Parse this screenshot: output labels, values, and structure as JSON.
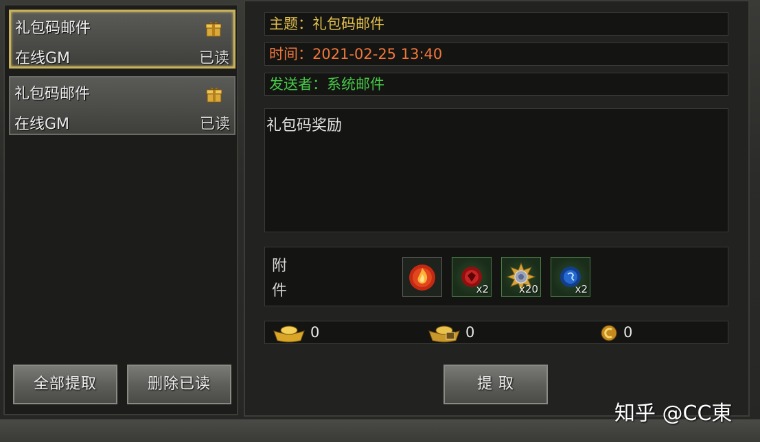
{
  "mail_list": [
    {
      "subject": "礼包码邮件",
      "sender": "在线GM",
      "status": "已读",
      "selected": true
    },
    {
      "subject": "礼包码邮件",
      "sender": "在线GM",
      "status": "已读",
      "selected": false
    }
  ],
  "buttons": {
    "claim_all": "全部提取",
    "delete_read": "删除已读",
    "claim": "提 取"
  },
  "detail": {
    "subject_label": "主题：",
    "subject": "礼包码邮件",
    "time_label": "时间：",
    "time": "2021-02-25 13:40",
    "sender_label": "发送者：",
    "sender": "系统邮件",
    "body": "礼包码奖励",
    "attachment_label": "附件",
    "attachments": [
      {
        "icon": "fire-orb-icon",
        "count": ""
      },
      {
        "icon": "red-gem-icon",
        "count": "x2"
      },
      {
        "icon": "gold-emblem-icon",
        "count": "x20"
      },
      {
        "icon": "blue-gem-icon",
        "count": "x2"
      }
    ]
  },
  "currency": {
    "gold_ingot": "0",
    "bound_ingot": "0",
    "coin": "0"
  },
  "watermark": "知乎 @CC東",
  "colors": {
    "subject": "#e3c04d",
    "time": "#f0773a",
    "sender": "#46c846",
    "selected_border": "#c9b35a"
  }
}
